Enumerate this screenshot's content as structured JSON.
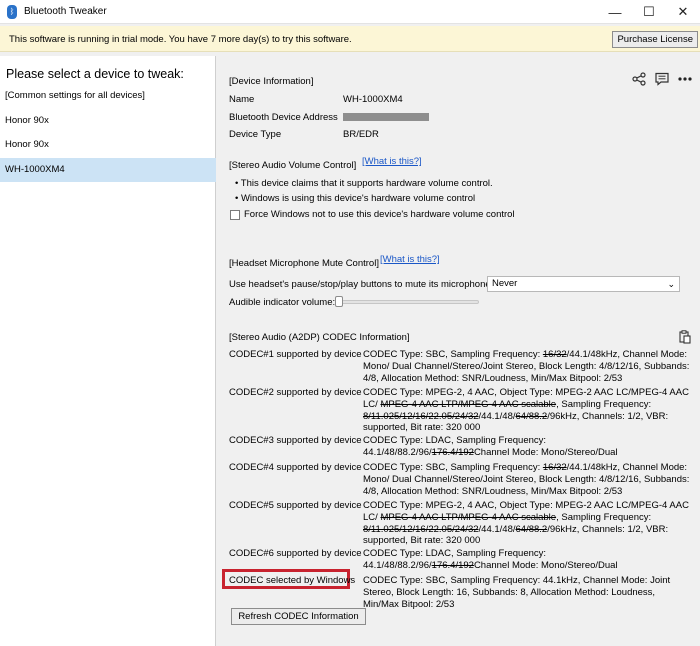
{
  "window": {
    "title": "Bluetooth Tweaker",
    "controls": [
      "—",
      "☐",
      "✕"
    ]
  },
  "trial": {
    "message": "This software is running in trial mode. You have 7 more day(s) to try this software.",
    "purchase_label": "Purchase License"
  },
  "left": {
    "heading": "Please select a device to tweak:",
    "devices": [
      {
        "label": "[Common settings for all devices]",
        "selected": false
      },
      {
        "label": "Honor 90x",
        "selected": false
      },
      {
        "label": "Honor 90x",
        "selected": false
      },
      {
        "label": "WH-1000XM4",
        "selected": true
      }
    ]
  },
  "device_info": {
    "title": "[Device Information]",
    "name_label": "Name",
    "name_value": "WH-1000XM4",
    "address_label": "Bluetooth Device Address",
    "type_label": "Device Type",
    "type_value": "BR/EDR"
  },
  "volume": {
    "title": "[Stereo Audio Volume Control]",
    "link": "[What is this?]",
    "bullet1": "This device claims that it supports hardware volume control.",
    "bullet2": "Windows is using this device's hardware volume control",
    "checkbox_label": "Force Windows not to use this device's hardware volume control"
  },
  "mic": {
    "title": "[Headset Microphone Mute Control]",
    "link": "[What is this?]",
    "dropdown_label": "Use headset's pause/stop/play buttons to mute its microphone:",
    "dropdown_value": "Never",
    "slider_label": "Audible indicator volume:",
    "slider_value": 0
  },
  "codec": {
    "title": "[Stereo Audio (A2DP) CODEC Information]",
    "refresh_label": "Refresh CODEC Information",
    "entries": [
      {
        "label": "CODEC#1 supported by device",
        "parts": [
          {
            "t": "CODEC Type: SBC, Sampling Frequency: "
          },
          {
            "t": "16/32",
            "s": true
          },
          {
            "t": "/44.1/48kHz, Channel Mode: Mono/ Dual Channel/Stereo/Joint Stereo, Block Length: 4/8/12/16, Subbands: 4/8, Allocation Method: SNR/Loudness, Min/Max Bitpool: 2/53"
          }
        ]
      },
      {
        "label": "CODEC#2 supported by device",
        "parts": [
          {
            "t": "CODEC Type: MPEG-2, 4 AAC, Object Type: MPEG-2 AAC LC/MPEG-4 AAC LC/ "
          },
          {
            "t": "MPEG-4 AAC LTP/MPEG-4 AAC scalable",
            "s": true
          },
          {
            "t": ", Sampling Frequency: "
          },
          {
            "t": "8/11.025/12/16/22.05/24/32",
            "s": true
          },
          {
            "t": "/44.1/48/"
          },
          {
            "t": "64/88.2",
            "s": true
          },
          {
            "t": "/96kHz, Channels: 1/2, VBR: supported, Bit rate: 320 000"
          }
        ]
      },
      {
        "label": "CODEC#3 supported by device",
        "parts": [
          {
            "t": "CODEC Type: LDAC, Sampling Frequency: 44.1/48/88.2/96/"
          },
          {
            "t": "176.4/192",
            "s": true
          },
          {
            "t": "Channel Mode: Mono/Stereo/Dual"
          }
        ]
      },
      {
        "label": "CODEC#4 supported by device",
        "parts": [
          {
            "t": "CODEC Type: SBC, Sampling Frequency: "
          },
          {
            "t": "16/32",
            "s": true
          },
          {
            "t": "/44.1/48kHz, Channel Mode: Mono/ Dual Channel/Stereo/Joint Stereo, Block Length: 4/8/12/16, Subbands: 4/8, Allocation Method: SNR/Loudness, Min/Max Bitpool: 2/53"
          }
        ]
      },
      {
        "label": "CODEC#5 supported by device",
        "parts": [
          {
            "t": "CODEC Type: MPEG-2, 4 AAC, Object Type: MPEG-2 AAC LC/MPEG-4 AAC LC/ "
          },
          {
            "t": "MPEG-4 AAC LTP/MPEG-4 AAC scalable",
            "s": true
          },
          {
            "t": ", Sampling Frequency: "
          },
          {
            "t": "8/11.025/12/16/22.05/24/32",
            "s": true
          },
          {
            "t": "/44.1/48/"
          },
          {
            "t": "64/88.2",
            "s": true
          },
          {
            "t": "/96kHz, Channels: 1/2, VBR: supported, Bit rate: 320 000"
          }
        ]
      },
      {
        "label": "CODEC#6 supported by device",
        "parts": [
          {
            "t": "CODEC Type: LDAC, Sampling Frequency: 44.1/48/88.2/96/"
          },
          {
            "t": "176.4/192",
            "s": true
          },
          {
            "t": "Channel Mode: Mono/Stereo/Dual"
          }
        ]
      },
      {
        "label": "CODEC selected by Windows",
        "highlighted": true,
        "parts": [
          {
            "t": "CODEC Type: SBC, Sampling Frequency: 44.1kHz, Channel Mode: Joint Stereo, Block Length: 16, Subbands: 8, Allocation Method: Loudness, Min/Max Bitpool: 2/53"
          }
        ]
      }
    ]
  },
  "icons": {
    "app": "bluetooth-icon",
    "share": "share-icon",
    "comment": "comment-icon",
    "more": "more-icon",
    "copy": "clipboard-icon"
  },
  "colors": {
    "selection": "#cce3f5",
    "trial_bg": "#fcf6d6",
    "link": "#1a57c7",
    "highlight": "#c8232f"
  }
}
